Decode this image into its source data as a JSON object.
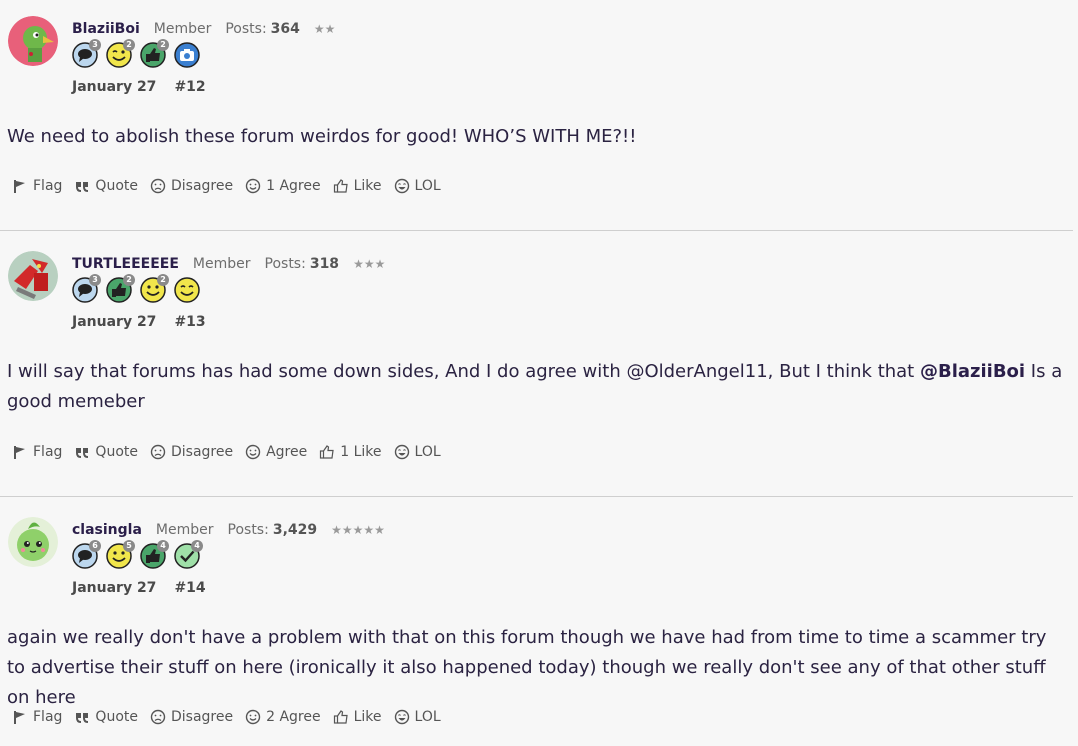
{
  "posts": [
    {
      "username": "BlaziiBoi",
      "role": "Member",
      "posts_label": "Posts:",
      "posts_count": "364",
      "stars": "★★",
      "badges": [
        {
          "icon": "speech-bubble-icon",
          "count": "3"
        },
        {
          "icon": "wink-face-icon",
          "count": "2"
        },
        {
          "icon": "thumbs-up-icon",
          "count": "2"
        },
        {
          "icon": "camera-icon",
          "count": ""
        }
      ],
      "date": "January 27",
      "number": "#12",
      "body_parts": [
        "We need to abolish these forum weirdos for good! WHO’S WITH ME?!!"
      ],
      "actions": {
        "flag": "Flag",
        "quote": "Quote",
        "disagree": "Disagree",
        "agree": "1 Agree",
        "like": "Like",
        "lol": "LOL"
      }
    },
    {
      "username": "TURTLEEEEEE",
      "role": "Member",
      "posts_label": "Posts:",
      "posts_count": "318",
      "stars": "★★★",
      "badges": [
        {
          "icon": "speech-bubble-icon",
          "count": "3"
        },
        {
          "icon": "thumbs-up-icon",
          "count": "2"
        },
        {
          "icon": "smile-face-icon",
          "count": "2"
        },
        {
          "icon": "wink-face-icon",
          "count": ""
        }
      ],
      "date": "January 27",
      "number": "#13",
      "body_parts": [
        "I will say that forums has had some down sides, And I do agree with @OlderAngel11, But I think that ",
        "@BlaziiBoi",
        " Is a good memeber"
      ],
      "actions": {
        "flag": "Flag",
        "quote": "Quote",
        "disagree": "Disagree",
        "agree": "Agree",
        "like": "1 Like",
        "lol": "LOL"
      }
    },
    {
      "username": "clasingla",
      "role": "Member",
      "posts_label": "Posts:",
      "posts_count": "3,429",
      "stars": "★★★★★",
      "badges": [
        {
          "icon": "speech-bubble-icon",
          "count": "6"
        },
        {
          "icon": "smile-face-icon",
          "count": "5"
        },
        {
          "icon": "thumbs-up-icon",
          "count": "4"
        },
        {
          "icon": "checkmark-icon",
          "count": "4"
        }
      ],
      "date": "January 27",
      "number": "#14",
      "body_parts": [
        "again we really don't have a problem with that on this forum though we have had from time to time a scammer try to advertise their stuff on here (ironically it also happened today) though we really don't see any of that other stuff on here"
      ],
      "actions": {
        "flag": "Flag",
        "quote": "Quote",
        "disagree": "Disagree",
        "agree": "2 Agree",
        "like": "Like",
        "lol": "LOL"
      }
    }
  ],
  "colors": {
    "text": "#2b2342",
    "muted": "#6d6d6d",
    "divider": "#cfcfcf",
    "background": "#f7f7f7"
  }
}
